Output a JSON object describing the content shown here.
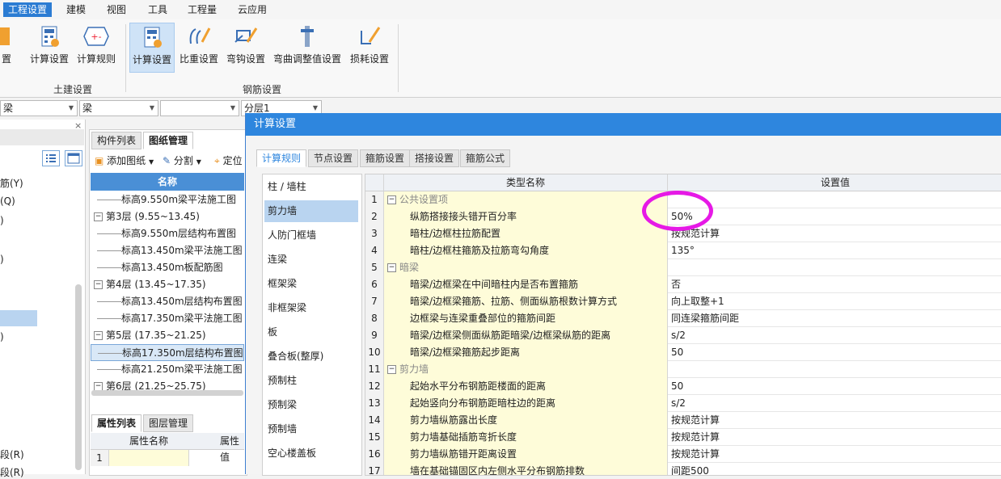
{
  "menu": [
    "工程设置",
    "建模",
    "视图",
    "工具",
    "工程量",
    "云应用"
  ],
  "ribbon": {
    "partial_label": "置",
    "civil_group": "土建设置",
    "civil_buttons": [
      "计算设置",
      "计算规则"
    ],
    "rebar_group": "钢筋设置",
    "rebar_buttons": [
      "计算设置",
      "比重设置",
      "弯钩设置",
      "弯曲调整值设置",
      "损耗设置"
    ]
  },
  "combos": [
    "梁",
    "梁",
    "",
    "分层1"
  ],
  "left_panel": {
    "items": [
      "筋(Y)",
      "(Q)",
      ")",
      ")",
      ")",
      "段(R)",
      "段(R)"
    ]
  },
  "middle_panel": {
    "tabs": [
      "构件列表",
      "图纸管理"
    ],
    "toolbar": {
      "add": "添加图纸",
      "split": "分割",
      "locate": "定位"
    },
    "column": "名称",
    "tree": [
      {
        "type": "child",
        "text": "标高9.550m梁平法施工图"
      },
      {
        "type": "floor",
        "text": "第3层 (9.55~13.45)"
      },
      {
        "type": "child",
        "text": "标高9.550m层结构布置图"
      },
      {
        "type": "child",
        "text": "标高13.450m梁平法施工图"
      },
      {
        "type": "child",
        "text": "标高13.450m板配筋图"
      },
      {
        "type": "floor",
        "text": "第4层 (13.45~17.35)"
      },
      {
        "type": "child",
        "text": "标高13.450m层结构布置图"
      },
      {
        "type": "child",
        "text": "标高17.350m梁平法施工图"
      },
      {
        "type": "floor",
        "text": "第5层 (17.35~21.25)"
      },
      {
        "type": "child",
        "text": "标高17.350m层结构布置图",
        "selected": true
      },
      {
        "type": "child",
        "text": "标高21.250m梁平法施工图"
      },
      {
        "type": "floor",
        "text": "第6层 (21.25~25.75)"
      }
    ],
    "prop_tabs": [
      "属性列表",
      "图层管理"
    ],
    "prop_cols": [
      "属性名称",
      "属性值"
    ],
    "prop_row": "1"
  },
  "dialog": {
    "title": "计算设置",
    "tabs": [
      "计算规则",
      "节点设置",
      "箍筋设置",
      "搭接设置",
      "箍筋公式"
    ],
    "categories": [
      "柱 / 墙柱",
      "剪力墙",
      "人防门框墙",
      "连梁",
      "框架梁",
      "非框架梁",
      "板",
      "叠合板(整厚)",
      "预制柱",
      "预制梁",
      "预制墙",
      "空心楼盖板"
    ],
    "selected_category": "剪力墙",
    "grid_header": {
      "name": "类型名称",
      "value": "设置值"
    },
    "rows": [
      {
        "n": "1",
        "group": true,
        "name": "公共设置项",
        "value": ""
      },
      {
        "n": "2",
        "name": "纵筋搭接接头错开百分率",
        "value": "50%"
      },
      {
        "n": "3",
        "name": "暗柱/边框柱拉筋配置",
        "value": "按规范计算"
      },
      {
        "n": "4",
        "name": "暗柱/边框柱箍筋及拉筋弯勾角度",
        "value": "135°"
      },
      {
        "n": "5",
        "group": true,
        "name": "暗梁",
        "value": ""
      },
      {
        "n": "6",
        "name": "暗梁/边框梁在中间暗柱内是否布置箍筋",
        "value": "否"
      },
      {
        "n": "7",
        "name": "暗梁/边框梁箍筋、拉筋、侧面纵筋根数计算方式",
        "value": "向上取整+1"
      },
      {
        "n": "8",
        "name": "边框梁与连梁重叠部位的箍筋间距",
        "value": "同连梁箍筋间距"
      },
      {
        "n": "9",
        "name": "暗梁/边框梁侧面纵筋距暗梁/边框梁纵筋的距离",
        "value": "s/2"
      },
      {
        "n": "10",
        "name": "暗梁/边框梁箍筋起步距离",
        "value": "50"
      },
      {
        "n": "11",
        "group": true,
        "name": "剪力墙",
        "value": ""
      },
      {
        "n": "12",
        "name": "起始水平分布钢筋距楼面的距离",
        "value": "50"
      },
      {
        "n": "13",
        "name": "起始竖向分布钢筋距暗柱边的距离",
        "value": "s/2"
      },
      {
        "n": "14",
        "name": "剪力墙纵筋露出长度",
        "value": "按规范计算"
      },
      {
        "n": "15",
        "name": "剪力墙基础插筋弯折长度",
        "value": "按规范计算"
      },
      {
        "n": "16",
        "name": "剪力墙纵筋错开距离设置",
        "value": "按规范计算"
      },
      {
        "n": "17",
        "name": "墙在基础锚固区内左侧水平分布钢筋排数",
        "value": "间距500"
      }
    ]
  },
  "colors": {
    "accent": "#2e86de",
    "highlight_circle": "#e619e6"
  }
}
